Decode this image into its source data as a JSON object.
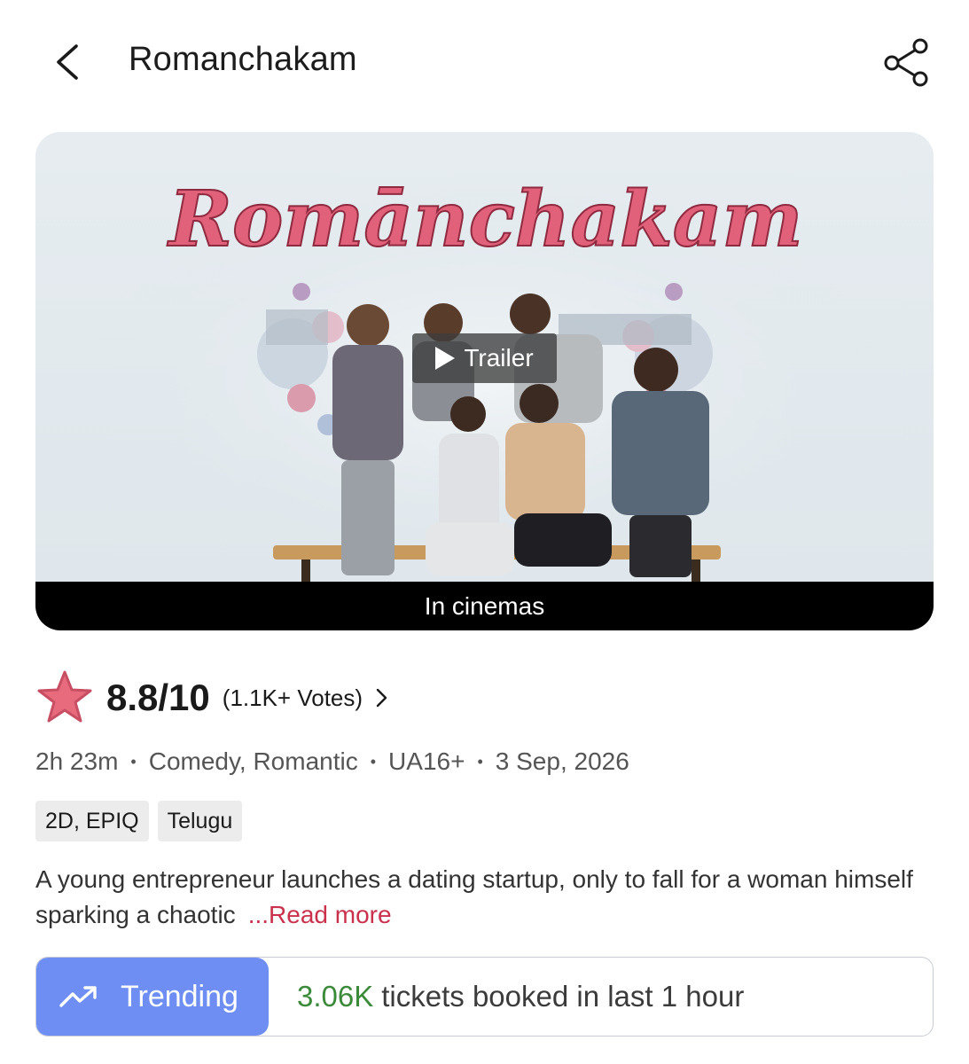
{
  "header": {
    "title": "Romanchakam"
  },
  "poster": {
    "logo_text": "Romānchakam",
    "trailer_label": "Trailer",
    "status_bar": "In cinemas"
  },
  "rating": {
    "value": "8.8/10",
    "votes": "(1.1K+ Votes)",
    "star_color": "#e76b7c"
  },
  "meta": {
    "duration": "2h 23m",
    "genres": "Comedy, Romantic",
    "certificate": "UA16+",
    "release_date": "3 Sep, 2026"
  },
  "tags": [
    "2D, EPIQ",
    "Telugu"
  ],
  "description": {
    "text": "A young entrepreneur launches a dating startup, only to fall for a woman himself sparking a chaotic",
    "read_more": "...Read more"
  },
  "trending": {
    "badge_label": "Trending",
    "count": "3.06K",
    "text": "tickets booked in last 1 hour",
    "badge_color": "#6f8ef3",
    "count_color": "#3a8a3a"
  }
}
